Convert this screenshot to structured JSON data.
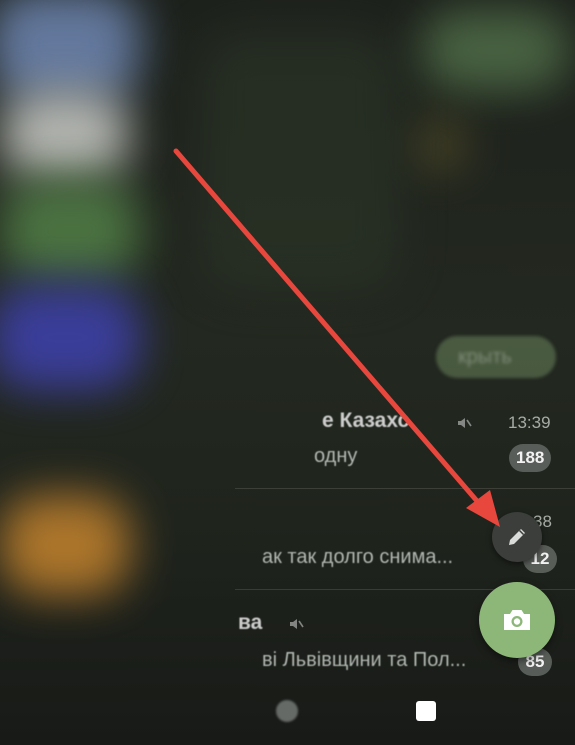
{
  "overlay": {
    "close_button_label": "крыть"
  },
  "chats": [
    {
      "title": "е Казахс",
      "muted": true,
      "time": "13:39",
      "preview": "одну",
      "unread": "188"
    },
    {
      "title": "",
      "muted": false,
      "time": "38",
      "preview": "ак так долго снима...",
      "unread": "12"
    },
    {
      "title": "ва",
      "muted": true,
      "time": "",
      "preview": "ві Львівщини та Пол...",
      "unread": "85"
    }
  ],
  "fabs": {
    "edit_icon": "pencil-icon",
    "camera_icon": "camera-icon"
  },
  "annotation": {
    "arrow_color": "#e8473d"
  },
  "colors": {
    "camera_fab": "#8db778",
    "edit_fab": "#3b3e3a",
    "badge": "#5f645f"
  },
  "nav": {
    "home_icon": "home-circle-icon",
    "recents_icon": "recents-square-icon"
  }
}
